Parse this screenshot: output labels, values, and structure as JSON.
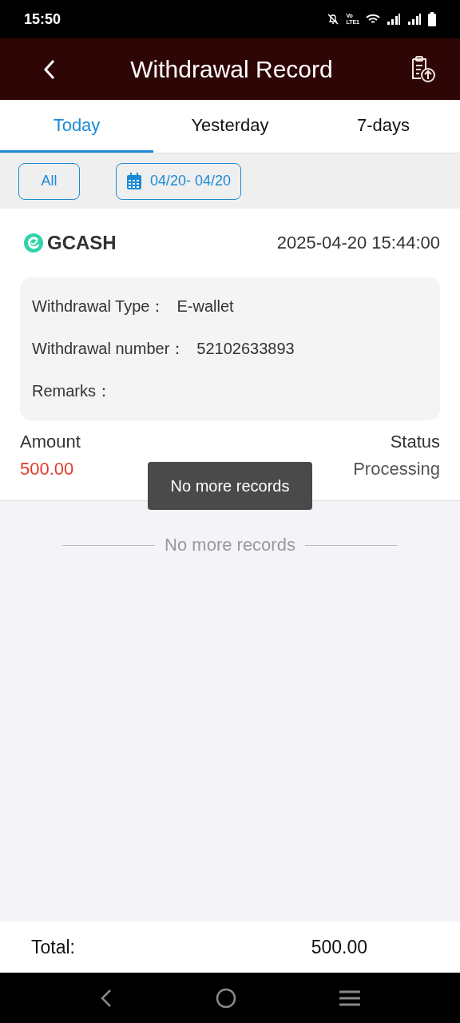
{
  "status_bar": {
    "time": "15:50",
    "volte_top": "Vo",
    "volte_bottom": "LTE1"
  },
  "header": {
    "title": "Withdrawal Record"
  },
  "tabs": [
    {
      "label": "Today",
      "selected": true
    },
    {
      "label": "Yesterday",
      "selected": false
    },
    {
      "label": "7-days",
      "selected": false
    }
  ],
  "filters": {
    "type": "All",
    "date_range": "04/20- 04/20"
  },
  "records": [
    {
      "method": "GCASH",
      "time": "2025-04-20 15:44:00",
      "details": [
        {
          "label": "Withdrawal Type：",
          "value": "E-wallet"
        },
        {
          "label": "Withdrawal number：",
          "value": "52102633893"
        },
        {
          "label": "Remarks："
        }
      ],
      "amount_label": "Amount",
      "amount": "500.00",
      "status_label": "Status",
      "status": "Processing"
    }
  ],
  "end_note": "No more records",
  "toast": "No more records",
  "total": {
    "label": "Total:",
    "value": "500.00"
  }
}
